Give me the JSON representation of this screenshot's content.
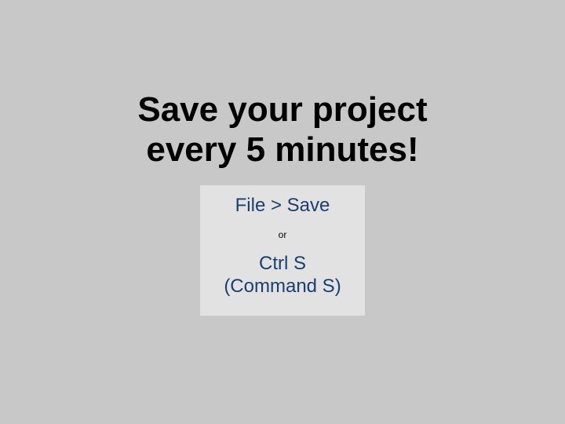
{
  "slide": {
    "heading_line1": "Save your project",
    "heading_line2": "every 5 minutes!",
    "menu_path": "File > Save",
    "separator": "or",
    "shortcut_line1": "Ctrl S",
    "shortcut_line2": "(Command S)"
  }
}
